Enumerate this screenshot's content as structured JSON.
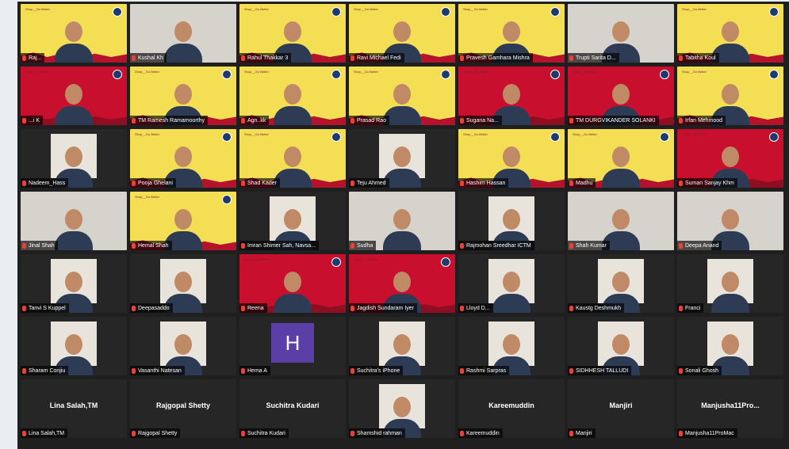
{
  "meeting": {
    "brand_text": "Shop__Go Better",
    "participants": [
      {
        "name": "Raj...",
        "bg": "yellow"
      },
      {
        "name": "Kushal Kh",
        "bg": "photo"
      },
      {
        "name": "Rahul Thakkar 3",
        "bg": "yellow"
      },
      {
        "name": "Ravi Michael Fedi",
        "bg": "yellow"
      },
      {
        "name": "Pravesh Gamhara Mishra",
        "bg": "yellow"
      },
      {
        "name": "Trupti Sarita D...",
        "bg": "photo"
      },
      {
        "name": "Tabitha Koul",
        "bg": "yellow"
      },
      {
        "name": "...i K",
        "bg": "red"
      },
      {
        "name": "TM Ramesh Ramamoorthy",
        "bg": "yellow"
      },
      {
        "name": "Agn..kk",
        "bg": "yellow"
      },
      {
        "name": "Prasad Rao",
        "bg": "yellow"
      },
      {
        "name": "Sugana Na...",
        "bg": "red"
      },
      {
        "name": "TM DURGVIKANDER SOLANKI",
        "bg": "red"
      },
      {
        "name": "Irfan Mehmood",
        "bg": "yellow"
      },
      {
        "name": "Nadeem_Hass",
        "bg": "dark"
      },
      {
        "name": "Pooja Ghelani",
        "bg": "yellow"
      },
      {
        "name": "Shad Kader",
        "bg": "yellow"
      },
      {
        "name": "Teju Ahmed",
        "bg": "dark"
      },
      {
        "name": "Hashim Hassan",
        "bg": "yellow"
      },
      {
        "name": "Madhu",
        "bg": "yellow"
      },
      {
        "name": "Suman Sanjay Khm",
        "bg": "red"
      },
      {
        "name": "Jinal Shah",
        "bg": "photo"
      },
      {
        "name": "Hemal Shah",
        "bg": "yellow"
      },
      {
        "name": "Imran Shimer Sah, Navsa...",
        "bg": "dark"
      },
      {
        "name": "Sudha",
        "bg": "photo"
      },
      {
        "name": "Rajmohan Sreedhar ICTM",
        "bg": "dark"
      },
      {
        "name": "Shah Kumar",
        "bg": "photo"
      },
      {
        "name": "Deepa Anand",
        "bg": "photo"
      },
      {
        "name": "Tanvi S Kuppel",
        "bg": "dark"
      },
      {
        "name": "Deepasaddo",
        "bg": "dark"
      },
      {
        "name": "Reena",
        "bg": "red"
      },
      {
        "name": "Jagdish Sundaram Iyer",
        "bg": "red"
      },
      {
        "name": "Lloyd D...",
        "bg": "dark"
      },
      {
        "name": "Kaustg Deshmukh",
        "bg": "dark"
      },
      {
        "name": "Franci",
        "bg": "dark"
      },
      {
        "name": "Sharam Conjiu",
        "bg": "dark"
      },
      {
        "name": "Vasanthi Natesan",
        "bg": "dark"
      },
      {
        "name": "Hema A",
        "bg": "dark",
        "avatar_letter": "H"
      },
      {
        "name": "Suchitra's iPhone",
        "bg": "dark"
      },
      {
        "name": "Rashmi Sarpras",
        "bg": "dark"
      },
      {
        "name": "SIDHHESH TALLUDI",
        "bg": "dark"
      },
      {
        "name": "Sonali Ghosh",
        "bg": "dark"
      },
      {
        "name": "Lina Salah,TM",
        "bg": "dark",
        "center_name": "Lina Salah,TM"
      },
      {
        "name": "Rajgopal Shetty",
        "bg": "dark",
        "center_name": "Rajgopal Shetty"
      },
      {
        "name": "Suchitra Kudari",
        "bg": "dark",
        "center_name": "Suchitra Kudari"
      },
      {
        "name": "Shamshid rahman",
        "bg": "dark"
      },
      {
        "name": "Kareemuddin",
        "bg": "dark",
        "center_name": "Kareemuddin"
      },
      {
        "name": "Manjiri",
        "bg": "dark",
        "center_name": "Manjiri"
      },
      {
        "name": "Manjusha11ProMac",
        "bg": "dark",
        "center_name": "Manjusha11Pro..."
      }
    ]
  }
}
